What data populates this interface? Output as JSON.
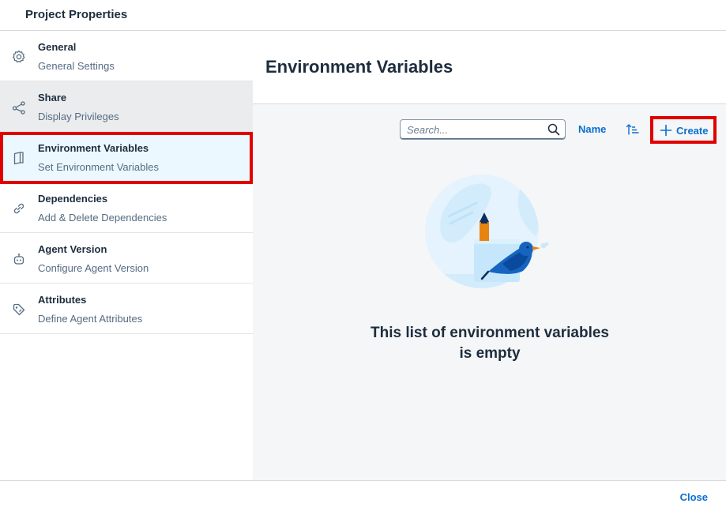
{
  "dialog": {
    "title": "Project Properties"
  },
  "sidebar": {
    "items": [
      {
        "title": "General",
        "subtitle": "General Settings",
        "icon": "gear-icon"
      },
      {
        "title": "Share",
        "subtitle": "Display Privileges",
        "icon": "share-icon"
      },
      {
        "title": "Environment Variables",
        "subtitle": "Set Environment Variables",
        "icon": "document-icon"
      },
      {
        "title": "Dependencies",
        "subtitle": "Add & Delete Dependencies",
        "icon": "link-icon"
      },
      {
        "title": "Agent Version",
        "subtitle": "Configure Agent Version",
        "icon": "robot-icon"
      },
      {
        "title": "Attributes",
        "subtitle": "Define Agent Attributes",
        "icon": "tag-icon"
      }
    ],
    "selected": "Environment Variables"
  },
  "content": {
    "title": "Environment Variables",
    "toolbar": {
      "search_placeholder": "Search...",
      "search_value": "",
      "name_label": "Name",
      "create_label": "Create"
    },
    "empty_state": {
      "line1": "This list of environment variables",
      "line2": "is empty"
    }
  },
  "footer": {
    "close_label": "Close"
  },
  "colors": {
    "accent": "#0a6ed1",
    "highlight_border": "#e00000",
    "selected_bg": "#ebf8ff",
    "content_bg": "#f5f6f7"
  }
}
